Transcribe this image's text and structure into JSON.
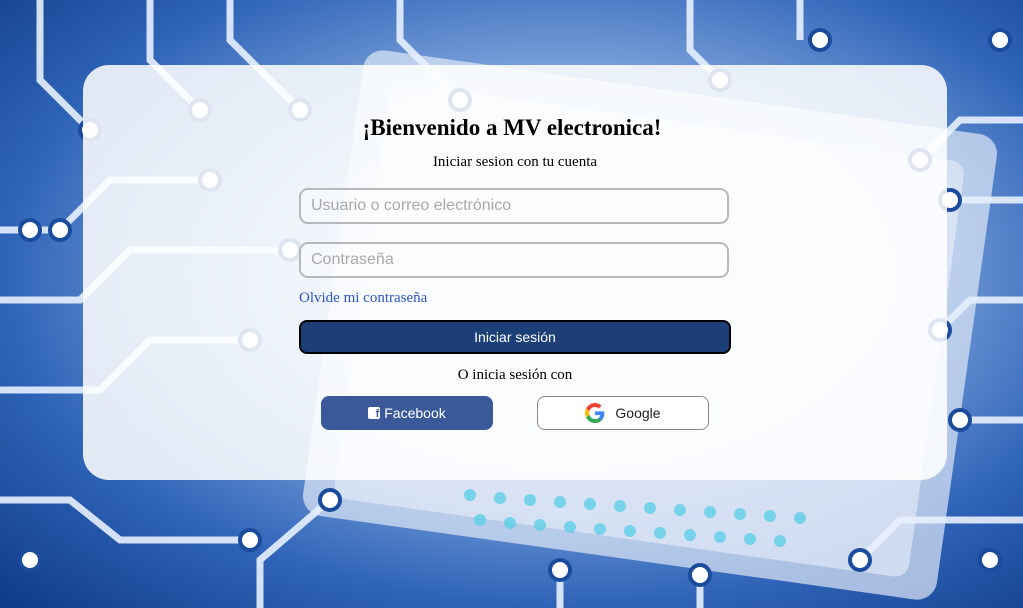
{
  "login": {
    "title": "¡Bienvenido a MV electronica!",
    "subtitle": "Iniciar sesion con tu cuenta",
    "username_placeholder": "Usuario o correo electrónico",
    "password_placeholder": "Contraseña",
    "forgot_link": "Olvide mi contraseña",
    "submit_label": "Iniciar sesión",
    "alt_login_text": "O inicia sesión con",
    "facebook_label": "Facebook",
    "google_label": "Google"
  },
  "icons": {
    "facebook": "facebook-square-icon",
    "google": "google-g-icon"
  },
  "colors": {
    "submit_bg": "#1c3f78",
    "facebook_bg": "#3b5998",
    "link": "#2a56c6"
  }
}
